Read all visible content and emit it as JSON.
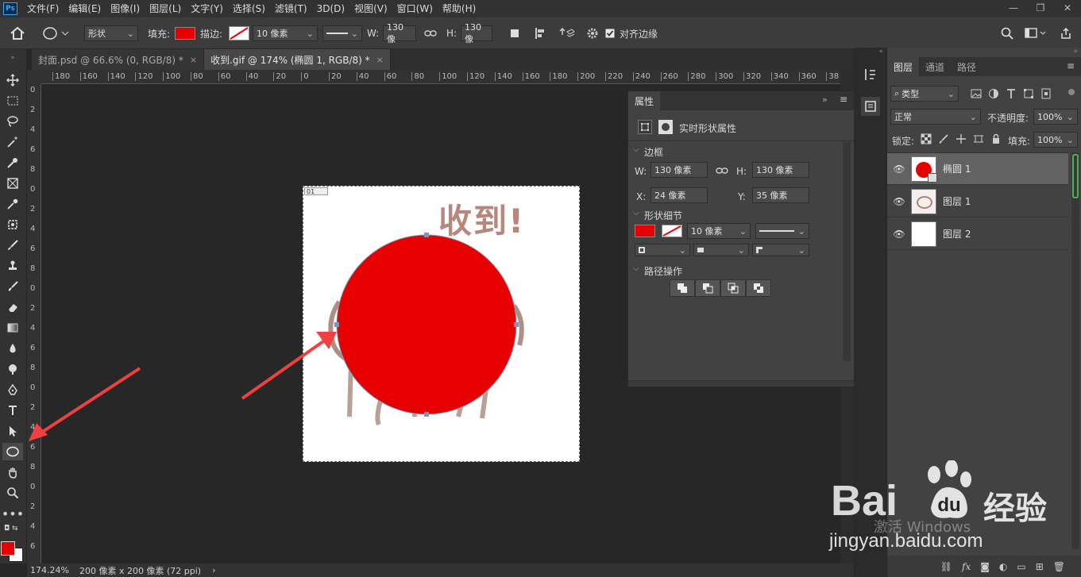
{
  "menubar": {
    "logo": "Ps",
    "items": [
      "文件(F)",
      "编辑(E)",
      "图像(I)",
      "图层(L)",
      "文字(Y)",
      "选择(S)",
      "滤镜(T)",
      "3D(D)",
      "视图(V)",
      "窗口(W)",
      "帮助(H)"
    ]
  },
  "window_controls": {
    "minimize": "—",
    "restore": "❐",
    "close": "✕"
  },
  "options": {
    "mode": "形状",
    "fill_label": "填充:",
    "fill_color": "#e60000",
    "stroke_label": "描边:",
    "stroke_width": "10 像素",
    "w_label": "W:",
    "w_value": "130 像",
    "h_label": "H:",
    "h_value": "130 像",
    "align_edges": "对齐边缘"
  },
  "tabs": [
    {
      "label": "封面.psd @ 66.6% (0, RGB/8) *",
      "close": "×"
    },
    {
      "label": "收到.gif @ 174% (椭圆 1, RGB/8) *",
      "close": "×"
    }
  ],
  "ruler": {
    "h_ticks": [
      "180",
      "160",
      "140",
      "120",
      "100",
      "80",
      "60",
      "40",
      "20",
      "0",
      "20",
      "40",
      "60",
      "80",
      "100",
      "120",
      "140",
      "160",
      "180",
      "200",
      "220",
      "240",
      "260",
      "280",
      "300",
      "320",
      "340",
      "360",
      "38"
    ],
    "v_ticks": [
      "0",
      "2",
      "4",
      "6",
      "8",
      "0",
      "2",
      "4",
      "6",
      "8",
      "0",
      "2",
      "4",
      "6",
      "8",
      "0",
      "2",
      "4",
      "6",
      "8",
      "0",
      "2",
      "4",
      "6"
    ]
  },
  "document": {
    "frame_label": "01",
    "text": "收到!",
    "ellipse_color": "#e60000"
  },
  "status": {
    "zoom": "174.24%",
    "size": "200 像素 x 200 像素 (72 ppi)",
    "arrow": "›"
  },
  "properties": {
    "title": "属性",
    "kind": "实时形状属性",
    "section_bounds": "边框",
    "w_label": "W:",
    "w_value": "130 像素",
    "h_label": "H:",
    "h_value": "130 像素",
    "x_label": "X:",
    "x_value": "24 像素",
    "y_label": "Y:",
    "y_value": "35 像素",
    "section_shape": "形状细节",
    "stroke_width": "10 像素",
    "section_path": "路径操作"
  },
  "layers": {
    "tabs": [
      "图层",
      "通道",
      "路径"
    ],
    "filter": "类型",
    "blend": "正常",
    "opacity_label": "不透明度:",
    "opacity": "100%",
    "lock_label": "锁定:",
    "fill_label": "填充:",
    "fill": "100%",
    "items": [
      {
        "name": "椭圆 1",
        "selected": true
      },
      {
        "name": "图层 1",
        "selected": false
      },
      {
        "name": "图层 2",
        "selected": false
      }
    ]
  },
  "watermark": {
    "brand": "Bai",
    "brand2": "经验",
    "windows": "激活 Windows",
    "url": "jingyan.baidu.com"
  }
}
